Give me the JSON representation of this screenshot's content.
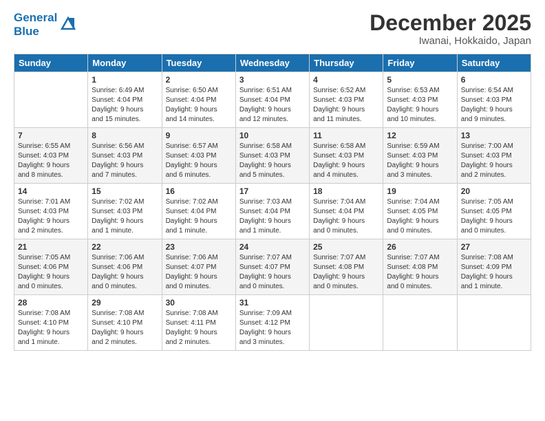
{
  "header": {
    "logo_line1": "General",
    "logo_line2": "Blue",
    "month": "December 2025",
    "location": "Iwanai, Hokkaido, Japan"
  },
  "weekdays": [
    "Sunday",
    "Monday",
    "Tuesday",
    "Wednesday",
    "Thursday",
    "Friday",
    "Saturday"
  ],
  "weeks": [
    [
      {
        "day": "",
        "info": ""
      },
      {
        "day": "1",
        "info": "Sunrise: 6:49 AM\nSunset: 4:04 PM\nDaylight: 9 hours\nand 15 minutes."
      },
      {
        "day": "2",
        "info": "Sunrise: 6:50 AM\nSunset: 4:04 PM\nDaylight: 9 hours\nand 14 minutes."
      },
      {
        "day": "3",
        "info": "Sunrise: 6:51 AM\nSunset: 4:04 PM\nDaylight: 9 hours\nand 12 minutes."
      },
      {
        "day": "4",
        "info": "Sunrise: 6:52 AM\nSunset: 4:03 PM\nDaylight: 9 hours\nand 11 minutes."
      },
      {
        "day": "5",
        "info": "Sunrise: 6:53 AM\nSunset: 4:03 PM\nDaylight: 9 hours\nand 10 minutes."
      },
      {
        "day": "6",
        "info": "Sunrise: 6:54 AM\nSunset: 4:03 PM\nDaylight: 9 hours\nand 9 minutes."
      }
    ],
    [
      {
        "day": "7",
        "info": "Sunrise: 6:55 AM\nSunset: 4:03 PM\nDaylight: 9 hours\nand 8 minutes."
      },
      {
        "day": "8",
        "info": "Sunrise: 6:56 AM\nSunset: 4:03 PM\nDaylight: 9 hours\nand 7 minutes."
      },
      {
        "day": "9",
        "info": "Sunrise: 6:57 AM\nSunset: 4:03 PM\nDaylight: 9 hours\nand 6 minutes."
      },
      {
        "day": "10",
        "info": "Sunrise: 6:58 AM\nSunset: 4:03 PM\nDaylight: 9 hours\nand 5 minutes."
      },
      {
        "day": "11",
        "info": "Sunrise: 6:58 AM\nSunset: 4:03 PM\nDaylight: 9 hours\nand 4 minutes."
      },
      {
        "day": "12",
        "info": "Sunrise: 6:59 AM\nSunset: 4:03 PM\nDaylight: 9 hours\nand 3 minutes."
      },
      {
        "day": "13",
        "info": "Sunrise: 7:00 AM\nSunset: 4:03 PM\nDaylight: 9 hours\nand 2 minutes."
      }
    ],
    [
      {
        "day": "14",
        "info": "Sunrise: 7:01 AM\nSunset: 4:03 PM\nDaylight: 9 hours\nand 2 minutes."
      },
      {
        "day": "15",
        "info": "Sunrise: 7:02 AM\nSunset: 4:03 PM\nDaylight: 9 hours\nand 1 minute."
      },
      {
        "day": "16",
        "info": "Sunrise: 7:02 AM\nSunset: 4:04 PM\nDaylight: 9 hours\nand 1 minute."
      },
      {
        "day": "17",
        "info": "Sunrise: 7:03 AM\nSunset: 4:04 PM\nDaylight: 9 hours\nand 1 minute."
      },
      {
        "day": "18",
        "info": "Sunrise: 7:04 AM\nSunset: 4:04 PM\nDaylight: 9 hours\nand 0 minutes."
      },
      {
        "day": "19",
        "info": "Sunrise: 7:04 AM\nSunset: 4:05 PM\nDaylight: 9 hours\nand 0 minutes."
      },
      {
        "day": "20",
        "info": "Sunrise: 7:05 AM\nSunset: 4:05 PM\nDaylight: 9 hours\nand 0 minutes."
      }
    ],
    [
      {
        "day": "21",
        "info": "Sunrise: 7:05 AM\nSunset: 4:06 PM\nDaylight: 9 hours\nand 0 minutes."
      },
      {
        "day": "22",
        "info": "Sunrise: 7:06 AM\nSunset: 4:06 PM\nDaylight: 9 hours\nand 0 minutes."
      },
      {
        "day": "23",
        "info": "Sunrise: 7:06 AM\nSunset: 4:07 PM\nDaylight: 9 hours\nand 0 minutes."
      },
      {
        "day": "24",
        "info": "Sunrise: 7:07 AM\nSunset: 4:07 PM\nDaylight: 9 hours\nand 0 minutes."
      },
      {
        "day": "25",
        "info": "Sunrise: 7:07 AM\nSunset: 4:08 PM\nDaylight: 9 hours\nand 0 minutes."
      },
      {
        "day": "26",
        "info": "Sunrise: 7:07 AM\nSunset: 4:08 PM\nDaylight: 9 hours\nand 0 minutes."
      },
      {
        "day": "27",
        "info": "Sunrise: 7:08 AM\nSunset: 4:09 PM\nDaylight: 9 hours\nand 1 minute."
      }
    ],
    [
      {
        "day": "28",
        "info": "Sunrise: 7:08 AM\nSunset: 4:10 PM\nDaylight: 9 hours\nand 1 minute."
      },
      {
        "day": "29",
        "info": "Sunrise: 7:08 AM\nSunset: 4:10 PM\nDaylight: 9 hours\nand 2 minutes."
      },
      {
        "day": "30",
        "info": "Sunrise: 7:08 AM\nSunset: 4:11 PM\nDaylight: 9 hours\nand 2 minutes."
      },
      {
        "day": "31",
        "info": "Sunrise: 7:09 AM\nSunset: 4:12 PM\nDaylight: 9 hours\nand 3 minutes."
      },
      {
        "day": "",
        "info": ""
      },
      {
        "day": "",
        "info": ""
      },
      {
        "day": "",
        "info": ""
      }
    ]
  ]
}
